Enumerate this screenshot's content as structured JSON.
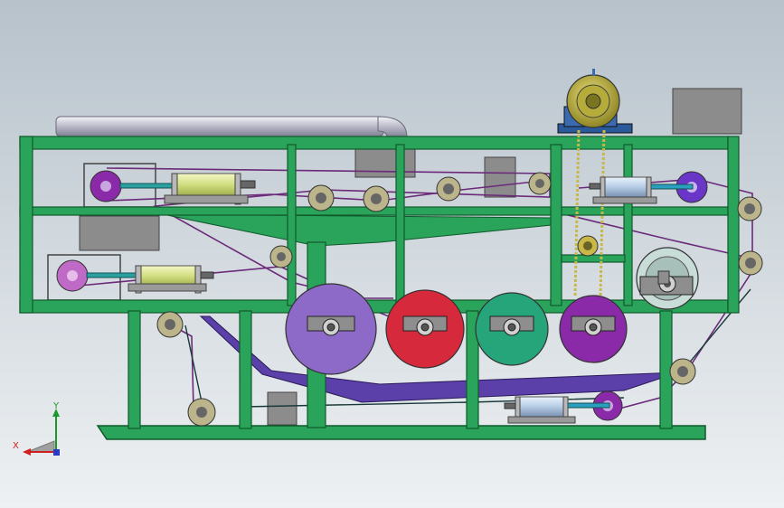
{
  "triad": {
    "x_label": "X",
    "y_label": "Y"
  },
  "colors": {
    "background_top": "#b9c4cc",
    "background_bottom": "#e9edf0",
    "frame": "#2aa35b",
    "frame_edge": "#0f5a2c",
    "roller_purple": "#8d6ac8",
    "roller_red": "#d62a3c",
    "roller_teal": "#27a57a",
    "roller_violet": "#8a2aa8",
    "cylinder": "#d8e48a",
    "motor": "#d6cb4a",
    "housing_gray": "#8e8e8e",
    "belt_purple": "#6b2a7a",
    "tray_purple": "#5a40a8",
    "chain": "#c8b84a"
  },
  "components": [
    {
      "name": "motor",
      "icon": "motor-icon"
    },
    {
      "name": "chain-drive",
      "icon": "sprocket-icon"
    },
    {
      "name": "press-roller-purple",
      "icon": "roller-icon"
    },
    {
      "name": "press-roller-red",
      "icon": "roller-icon"
    },
    {
      "name": "press-roller-teal",
      "icon": "roller-icon"
    },
    {
      "name": "press-roller-violet",
      "icon": "roller-icon"
    },
    {
      "name": "pneumatic-cylinder",
      "icon": "cylinder-icon"
    },
    {
      "name": "feed-pipe",
      "icon": "pipe-icon"
    }
  ]
}
